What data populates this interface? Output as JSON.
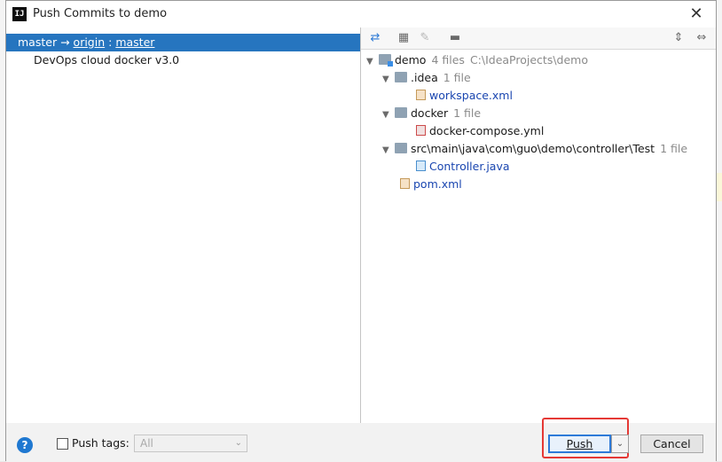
{
  "window": {
    "title": "Push Commits to demo",
    "app_icon": "IJ"
  },
  "left": {
    "branch": {
      "source": "master",
      "arrow": "→",
      "remote": "origin",
      "sep": ":",
      "target": "master"
    },
    "commits": [
      "DevOps cloud docker v3.0"
    ]
  },
  "right": {
    "tree": {
      "root": {
        "name": "demo",
        "meta": "4 files",
        "path": "C:\\IdeaProjects\\demo"
      },
      "idea": {
        "name": ".idea",
        "meta": "1 file"
      },
      "workspace": {
        "name": "workspace.xml"
      },
      "docker": {
        "name": "docker",
        "meta": "1 file"
      },
      "compose": {
        "name": "docker-compose.yml"
      },
      "src": {
        "name": "src\\main\\java\\com\\guo\\demo\\controller\\Test",
        "meta": "1 file"
      },
      "controller": {
        "name": "Controller.java"
      },
      "pom": {
        "name": "pom.xml"
      }
    }
  },
  "bottom": {
    "help": "?",
    "push_tags_label": "Push tags:",
    "tags_value": "All",
    "push": "Push",
    "cancel": "Cancel"
  },
  "colors": {
    "selection": "#2675bf",
    "highlight": "#e53935",
    "link": "#1a46b0"
  }
}
